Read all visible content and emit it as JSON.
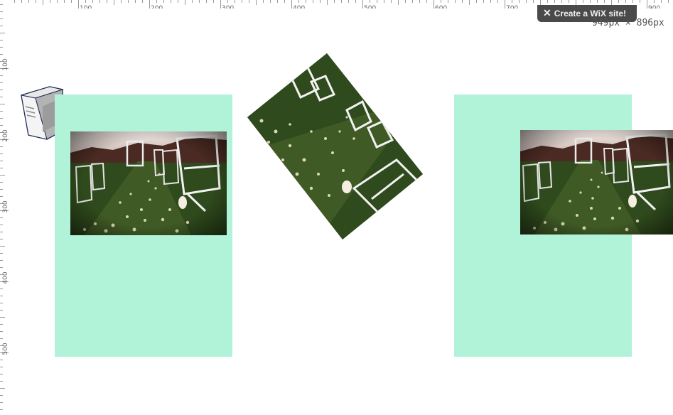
{
  "ruler": {
    "top_labels": [
      "100",
      "200",
      "300",
      "400",
      "500",
      "600",
      "700",
      "800",
      "900"
    ],
    "left_labels": [
      "100",
      "200",
      "300",
      "400",
      "500"
    ]
  },
  "badge": {
    "label": "Create a WiX site!",
    "icon": "wix-x-icon"
  },
  "canvas": {
    "size_label": "949px × 896px"
  },
  "colors": {
    "panel": "#b0f3d8",
    "badge_bg": "#4a4a4a"
  },
  "items": {
    "left_panel": "mint-rectangle",
    "center_photo": "wedding-aisle-photo-rotated",
    "right_panel": "mint-rectangle",
    "server_icon": "server-icon"
  }
}
